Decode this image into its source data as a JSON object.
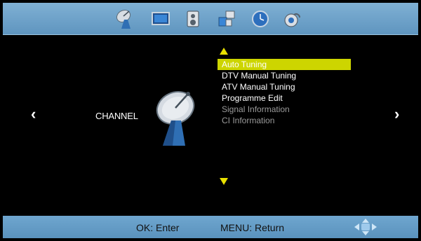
{
  "top_tabs": [
    {
      "name": "channel"
    },
    {
      "name": "picture"
    },
    {
      "name": "sound"
    },
    {
      "name": "time"
    },
    {
      "name": "option"
    },
    {
      "name": "lock"
    }
  ],
  "nav": {
    "left_glyph": "‹",
    "right_glyph": "›"
  },
  "section": {
    "label": "CHANNEL",
    "icon": "satellite-dish-icon"
  },
  "menu": {
    "items": [
      {
        "label": "Auto Tuning",
        "state": "selected"
      },
      {
        "label": "DTV Manual Tuning",
        "state": "enabled"
      },
      {
        "label": "ATV Manual Tuning",
        "state": "enabled"
      },
      {
        "label": "Programme Edit",
        "state": "enabled"
      },
      {
        "label": "Signal Information",
        "state": "disabled"
      },
      {
        "label": "CI Information",
        "state": "disabled"
      }
    ]
  },
  "footer": {
    "ok_hint": "OK: Enter",
    "menu_hint": "MENU: Return",
    "nav_icon": "directional-pad-icon"
  },
  "colors": {
    "bar": "#6aa2cc",
    "highlight": "#cdd500",
    "scroll_arrows": "#e8e000",
    "disabled_text": "#9a9a9a"
  }
}
